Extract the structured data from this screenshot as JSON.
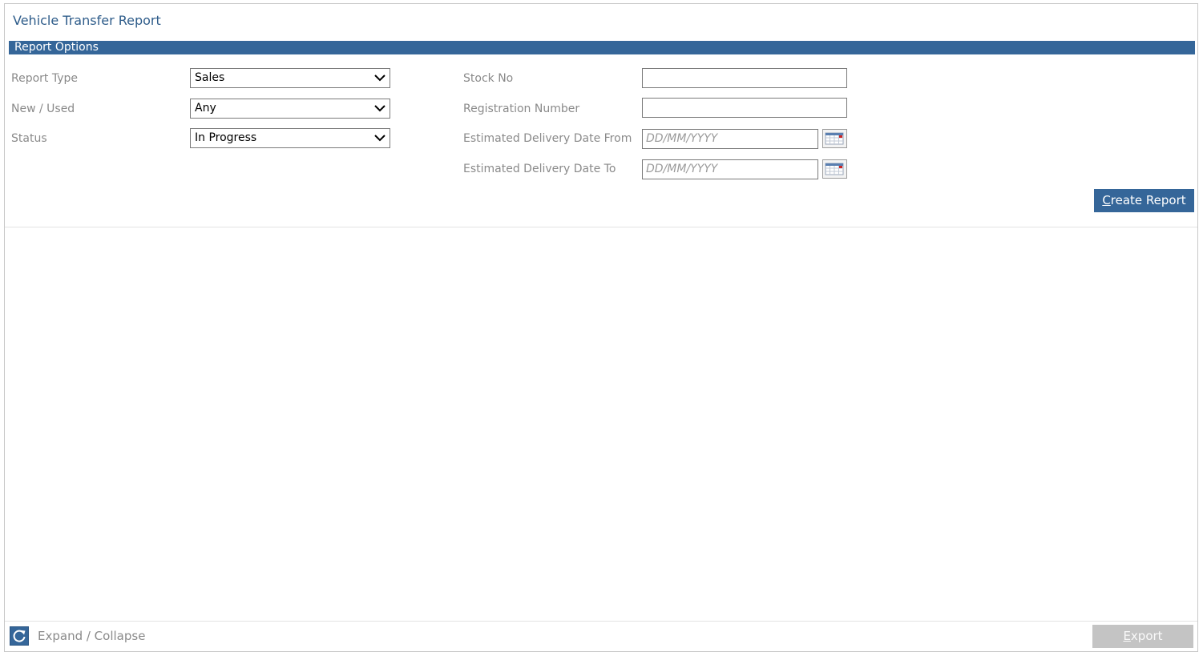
{
  "page": {
    "title": "Vehicle Transfer Report"
  },
  "section": {
    "title": "Report Options"
  },
  "left_fields": {
    "report_type": {
      "label": "Report Type",
      "value": "Sales"
    },
    "new_used": {
      "label": "New / Used",
      "value": "Any"
    },
    "status": {
      "label": "Status",
      "value": "In Progress"
    }
  },
  "right_fields": {
    "stock_no": {
      "label": "Stock No",
      "value": ""
    },
    "registration_number": {
      "label": "Registration Number",
      "value": ""
    },
    "delivery_from": {
      "label": "Estimated Delivery Date From",
      "placeholder": "DD/MM/YYYY"
    },
    "delivery_to": {
      "label": "Estimated Delivery Date To",
      "placeholder": "DD/MM/YYYY"
    }
  },
  "actions": {
    "create_report_first": "C",
    "create_report_rest": "reate Report",
    "export_first": "E",
    "export_rest": "xport"
  },
  "footer": {
    "expand_collapse": "Expand / Collapse"
  },
  "icons": {
    "dropdown": "chevron-down-icon",
    "calendar": "calendar-icon",
    "refresh": "refresh-icon"
  },
  "colors": {
    "accent": "#356699",
    "title": "#2e5c8a",
    "label": "#8a8a8a",
    "disabled": "#c4c4c4"
  }
}
